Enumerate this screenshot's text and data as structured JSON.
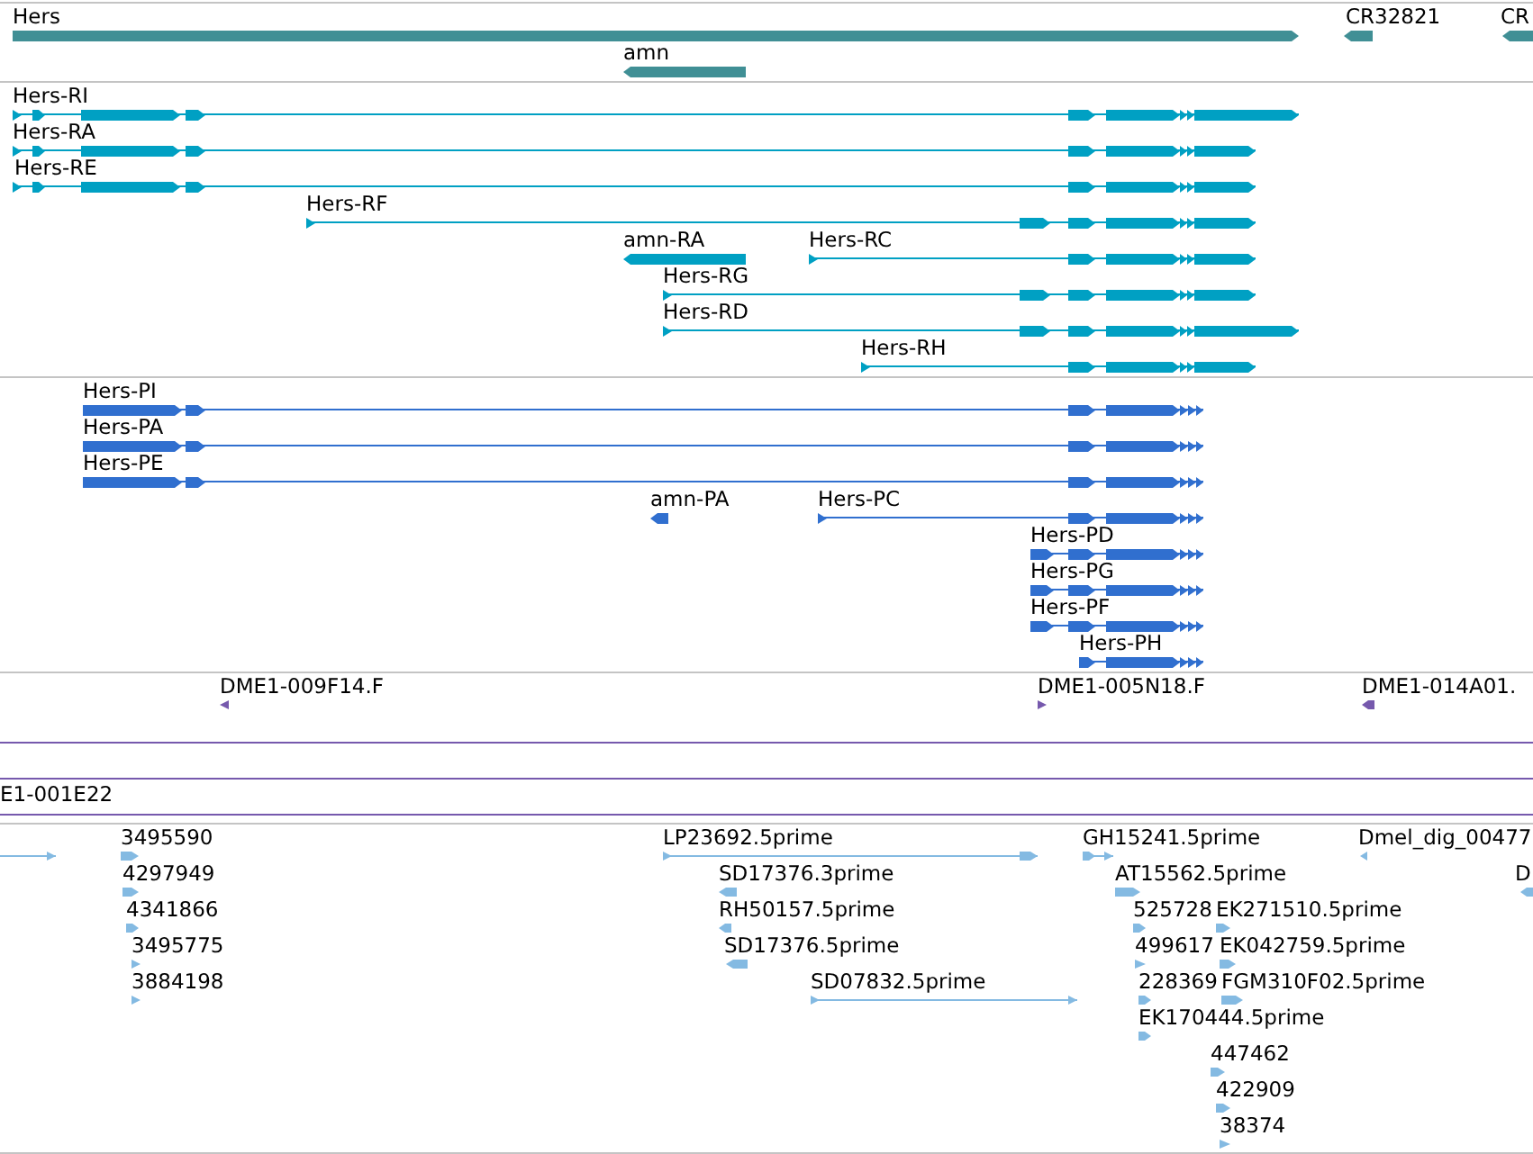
{
  "tracks": [
    {
      "kind": "gene",
      "tiers": [
        {
          "features": [
            {
              "kind": "bar",
              "label": "Hers",
              "reverse": false
            },
            {
              "kind": "bar",
              "label": "CR32821",
              "reverse": true
            },
            {
              "kind": "bar",
              "label": "CR",
              "reverse": true
            }
          ]
        },
        {
          "features": [
            {
              "kind": "bar",
              "label": "amn",
              "reverse": true
            }
          ]
        }
      ]
    },
    {
      "kind": "transcript",
      "tiers": [
        {
          "features": [
            {
              "kind": "model",
              "label": "Hers-RI",
              "reverse": false
            }
          ]
        },
        {
          "features": [
            {
              "kind": "model",
              "label": "Hers-RA",
              "reverse": false
            }
          ]
        },
        {
          "features": [
            {
              "kind": "model",
              "label": "Hers-RE",
              "reverse": false
            }
          ]
        },
        {
          "features": [
            {
              "kind": "model",
              "label": "Hers-RF",
              "reverse": false
            }
          ]
        },
        {
          "features": [
            {
              "kind": "bar",
              "label": "amn-RA",
              "reverse": true
            },
            {
              "kind": "model",
              "label": "Hers-RC",
              "reverse": false
            }
          ]
        },
        {
          "features": [
            {
              "kind": "model",
              "label": "Hers-RG",
              "reverse": false
            }
          ]
        },
        {
          "features": [
            {
              "kind": "model",
              "label": "Hers-RD",
              "reverse": false
            }
          ]
        },
        {
          "features": [
            {
              "kind": "model",
              "label": "Hers-RH",
              "reverse": false
            }
          ]
        }
      ]
    },
    {
      "kind": "protein",
      "tiers": [
        {
          "features": [
            {
              "kind": "model",
              "label": "Hers-PI",
              "reverse": false
            }
          ]
        },
        {
          "features": [
            {
              "kind": "model",
              "label": "Hers-PA",
              "reverse": false
            }
          ]
        },
        {
          "features": [
            {
              "kind": "model",
              "label": "Hers-PE",
              "reverse": false
            }
          ]
        },
        {
          "features": [
            {
              "kind": "bar",
              "label": "amn-PA",
              "reverse": true
            },
            {
              "kind": "model",
              "label": "Hers-PC",
              "reverse": false
            }
          ]
        },
        {
          "features": [
            {
              "kind": "model",
              "label": "Hers-PD",
              "reverse": false
            }
          ]
        },
        {
          "features": [
            {
              "kind": "model",
              "label": "Hers-PG",
              "reverse": false
            }
          ]
        },
        {
          "features": [
            {
              "kind": "model",
              "label": "Hers-PF",
              "reverse": false
            }
          ]
        },
        {
          "features": [
            {
              "kind": "model",
              "label": "Hers-PH",
              "reverse": false
            }
          ]
        }
      ]
    },
    {
      "kind": "clone",
      "tiers": [
        {
          "features": [
            {
              "kind": "marker",
              "label": "DME1-009F14.F",
              "reverse": true
            },
            {
              "kind": "marker",
              "label": "DME1-005N18.F",
              "reverse": false
            },
            {
              "kind": "marker",
              "label": "DME1-014A01.",
              "reverse": true
            }
          ]
        },
        {
          "features": [
            {
              "kind": "span"
            }
          ]
        },
        {
          "features": [
            {
              "kind": "span"
            }
          ]
        },
        {
          "features": [
            {
              "kind": "span",
              "label": "E1-001E22"
            }
          ]
        }
      ]
    },
    {
      "kind": "est",
      "tiers": [
        {
          "features": [
            {
              "kind": "model",
              "reverse": false
            },
            {
              "kind": "marker",
              "label": "3495590",
              "reverse": false
            },
            {
              "kind": "model",
              "label": "LP23692.5prime",
              "reverse": false
            },
            {
              "kind": "model",
              "label": "GH15241.5prime",
              "reverse": false
            },
            {
              "kind": "marker",
              "label": "Dmel_dig_00477",
              "reverse": true
            }
          ]
        },
        {
          "features": [
            {
              "kind": "marker",
              "label": "4297949",
              "reverse": false
            },
            {
              "kind": "marker",
              "label": "SD17376.3prime",
              "reverse": true
            },
            {
              "kind": "marker",
              "label": "AT15562.5prime",
              "reverse": false
            },
            {
              "kind": "marker",
              "label": "D",
              "reverse": true
            }
          ]
        },
        {
          "features": [
            {
              "kind": "marker",
              "label": "4341866",
              "reverse": false
            },
            {
              "kind": "marker",
              "label": "RH50157.5prime",
              "reverse": true
            },
            {
              "kind": "marker",
              "label": "525728",
              "reverse": false
            },
            {
              "kind": "marker",
              "label": "EK271510.5prime",
              "reverse": false
            }
          ]
        },
        {
          "features": [
            {
              "kind": "marker",
              "label": "3495775",
              "reverse": false
            },
            {
              "kind": "marker",
              "label": "SD17376.5prime",
              "reverse": true
            },
            {
              "kind": "marker",
              "label": "499617",
              "reverse": false
            },
            {
              "kind": "marker",
              "label": "EK042759.5prime",
              "reverse": false
            }
          ]
        },
        {
          "features": [
            {
              "kind": "marker",
              "label": "3884198",
              "reverse": false
            },
            {
              "kind": "model",
              "label": "SD07832.5prime",
              "reverse": false
            },
            {
              "kind": "marker",
              "label": "228369",
              "reverse": false
            },
            {
              "kind": "marker",
              "label": "FGM310F02.5prime",
              "reverse": false
            }
          ]
        },
        {
          "features": [
            {
              "kind": "marker",
              "label": "EK170444.5prime",
              "reverse": false
            }
          ]
        },
        {
          "features": [
            {
              "kind": "marker",
              "label": "447462",
              "reverse": false
            }
          ]
        },
        {
          "features": [
            {
              "kind": "marker",
              "label": "422909",
              "reverse": false
            }
          ]
        },
        {
          "features": [
            {
              "kind": "marker",
              "label": "38374",
              "reverse": false
            }
          ]
        }
      ]
    }
  ]
}
